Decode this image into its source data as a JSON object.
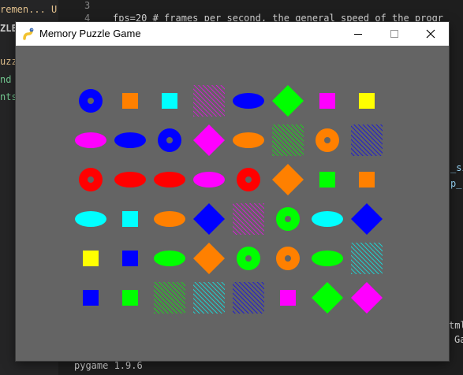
{
  "window": {
    "title": "Memory Puzzle Game",
    "background": "#646464",
    "controls": {
      "minimize": "minimize-icon",
      "maximize": "maximize-icon",
      "close": "close-icon"
    }
  },
  "editor": {
    "tab_label": "remen...",
    "tab_status": "U",
    "sidebar_title": "ZLE",
    "sidebar_items": [
      "uzz",
      "nd",
      "nts.t"
    ],
    "line_numbers": [
      "3",
      "4"
    ],
    "code_line": "fps=20 # frames per second, the general speed of the progr",
    "right_fragments": [
      "_si",
      "p_",
      "tml",
      "Ga"
    ],
    "terminal_text": "pygame 1.9.6"
  },
  "board": {
    "colors": {
      "red": "#ff0000",
      "green": "#00ff00",
      "blue": "#0000ff",
      "yellow": "#ffff00",
      "orange": "#ff8000",
      "purple": "#ff00ff",
      "cyan": "#00ffff",
      "gray": "#646464"
    },
    "rows": [
      [
        {
          "shape": "donut",
          "color": "blue"
        },
        {
          "shape": "square",
          "color": "orange"
        },
        {
          "shape": "square",
          "color": "cyan"
        },
        {
          "shape": "lines",
          "color": "purple"
        },
        {
          "shape": "oval",
          "color": "blue"
        },
        {
          "shape": "diamond",
          "color": "green"
        },
        {
          "shape": "square",
          "color": "purple"
        },
        {
          "shape": "square",
          "color": "yellow"
        }
      ],
      [
        {
          "shape": "oval",
          "color": "purple"
        },
        {
          "shape": "oval",
          "color": "blue"
        },
        {
          "shape": "donut",
          "color": "blue"
        },
        {
          "shape": "diamond",
          "color": "purple"
        },
        {
          "shape": "oval",
          "color": "orange"
        },
        {
          "shape": "lines",
          "color": "green"
        },
        {
          "shape": "donut",
          "color": "orange"
        },
        {
          "shape": "lines",
          "color": "blue"
        }
      ],
      [
        {
          "shape": "donut",
          "color": "red"
        },
        {
          "shape": "oval",
          "color": "red"
        },
        {
          "shape": "oval",
          "color": "red"
        },
        {
          "shape": "oval",
          "color": "purple"
        },
        {
          "shape": "donut",
          "color": "red"
        },
        {
          "shape": "diamond",
          "color": "orange"
        },
        {
          "shape": "square",
          "color": "green"
        },
        {
          "shape": "square",
          "color": "orange"
        }
      ],
      [
        {
          "shape": "oval",
          "color": "cyan"
        },
        {
          "shape": "square",
          "color": "cyan"
        },
        {
          "shape": "oval",
          "color": "orange"
        },
        {
          "shape": "diamond",
          "color": "blue"
        },
        {
          "shape": "lines",
          "color": "purple"
        },
        {
          "shape": "donut",
          "color": "green"
        },
        {
          "shape": "oval",
          "color": "cyan"
        },
        {
          "shape": "diamond",
          "color": "blue"
        }
      ],
      [
        {
          "shape": "square",
          "color": "yellow"
        },
        {
          "shape": "square",
          "color": "blue"
        },
        {
          "shape": "oval",
          "color": "green"
        },
        {
          "shape": "diamond",
          "color": "orange"
        },
        {
          "shape": "donut",
          "color": "green"
        },
        {
          "shape": "donut",
          "color": "orange"
        },
        {
          "shape": "oval",
          "color": "green"
        },
        {
          "shape": "lines",
          "color": "cyan"
        }
      ],
      [
        {
          "shape": "square",
          "color": "blue"
        },
        {
          "shape": "square",
          "color": "green"
        },
        {
          "shape": "lines",
          "color": "green"
        },
        {
          "shape": "lines",
          "color": "cyan"
        },
        {
          "shape": "lines",
          "color": "blue"
        },
        {
          "shape": "square",
          "color": "purple"
        },
        {
          "shape": "diamond",
          "color": "green"
        },
        {
          "shape": "diamond",
          "color": "purple"
        }
      ]
    ]
  }
}
